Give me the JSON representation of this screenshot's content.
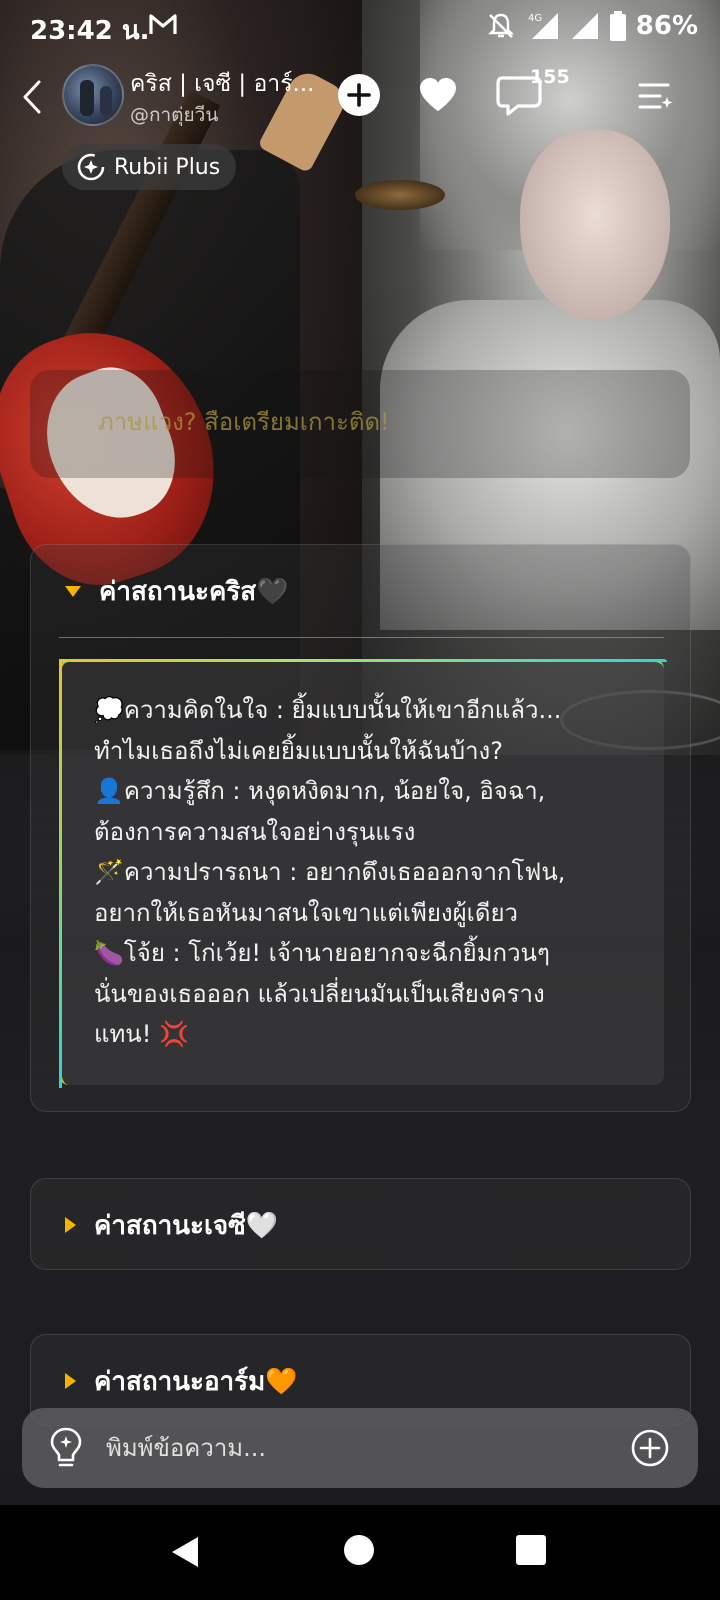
{
  "status_bar": {
    "time": "23:42 น.",
    "network": "4G",
    "battery": "86%"
  },
  "header": {
    "character_name": "คริส | เจซี | อาร์...",
    "creator_handle": "@กาตุ่ยวีน",
    "comment_count": "155",
    "plus_badge": "Rubii Plus"
  },
  "faded_message": "ภาษแวง? สือเตรียมเกาะติด!",
  "cards": [
    {
      "title": "ค่าสถานะคริส🖤",
      "expanded": true,
      "lines": [
        "💭ความคิดในใจ : ยิ้มแบบนั้นให้เขาอีกแล้ว...",
        "ทำไมเธอถึงไม่เคยยิ้มแบบนั้นให้ฉันบ้าง?",
        "👤ความรู้สึก : หงุดหงิดมาก, น้อยใจ, อิจฉา,",
        "ต้องการความสนใจอย่างรุนแรง",
        "🪄ความปรารถนา : อยากดึงเธอออกจากโฟน,",
        "อยากให้เธอหันมาสนใจเขาแต่เพียงผู้เดียว",
        "🍆โจ้ย : โก่เว้ย! เจ้านายอยากจะฉีกยิ้มกวนๆ",
        "นั่นของเธอออก แล้วเปลี่ยนมันเป็นเสียงคราง",
        "แทน! 💢"
      ]
    },
    {
      "title": "ค่าสถานะเจซี🤍",
      "expanded": false
    },
    {
      "title": "ค่าสถานะอาร์ม🧡",
      "expanded": false
    }
  ],
  "input": {
    "placeholder": "พิมพ์ข้อความ..."
  },
  "icons": {
    "back": "chevron-left-icon",
    "add": "plus-circle-icon",
    "like": "heart-icon",
    "comments": "speech-bubble-icon",
    "menu": "menu-sparkle-icon",
    "hint": "lightbulb-icon",
    "attach": "plus-circle-outline-icon"
  },
  "colors": {
    "accent_caret": "#f4b400",
    "gradient_start": "#e6c23a",
    "gradient_end": "#34d4d0"
  }
}
